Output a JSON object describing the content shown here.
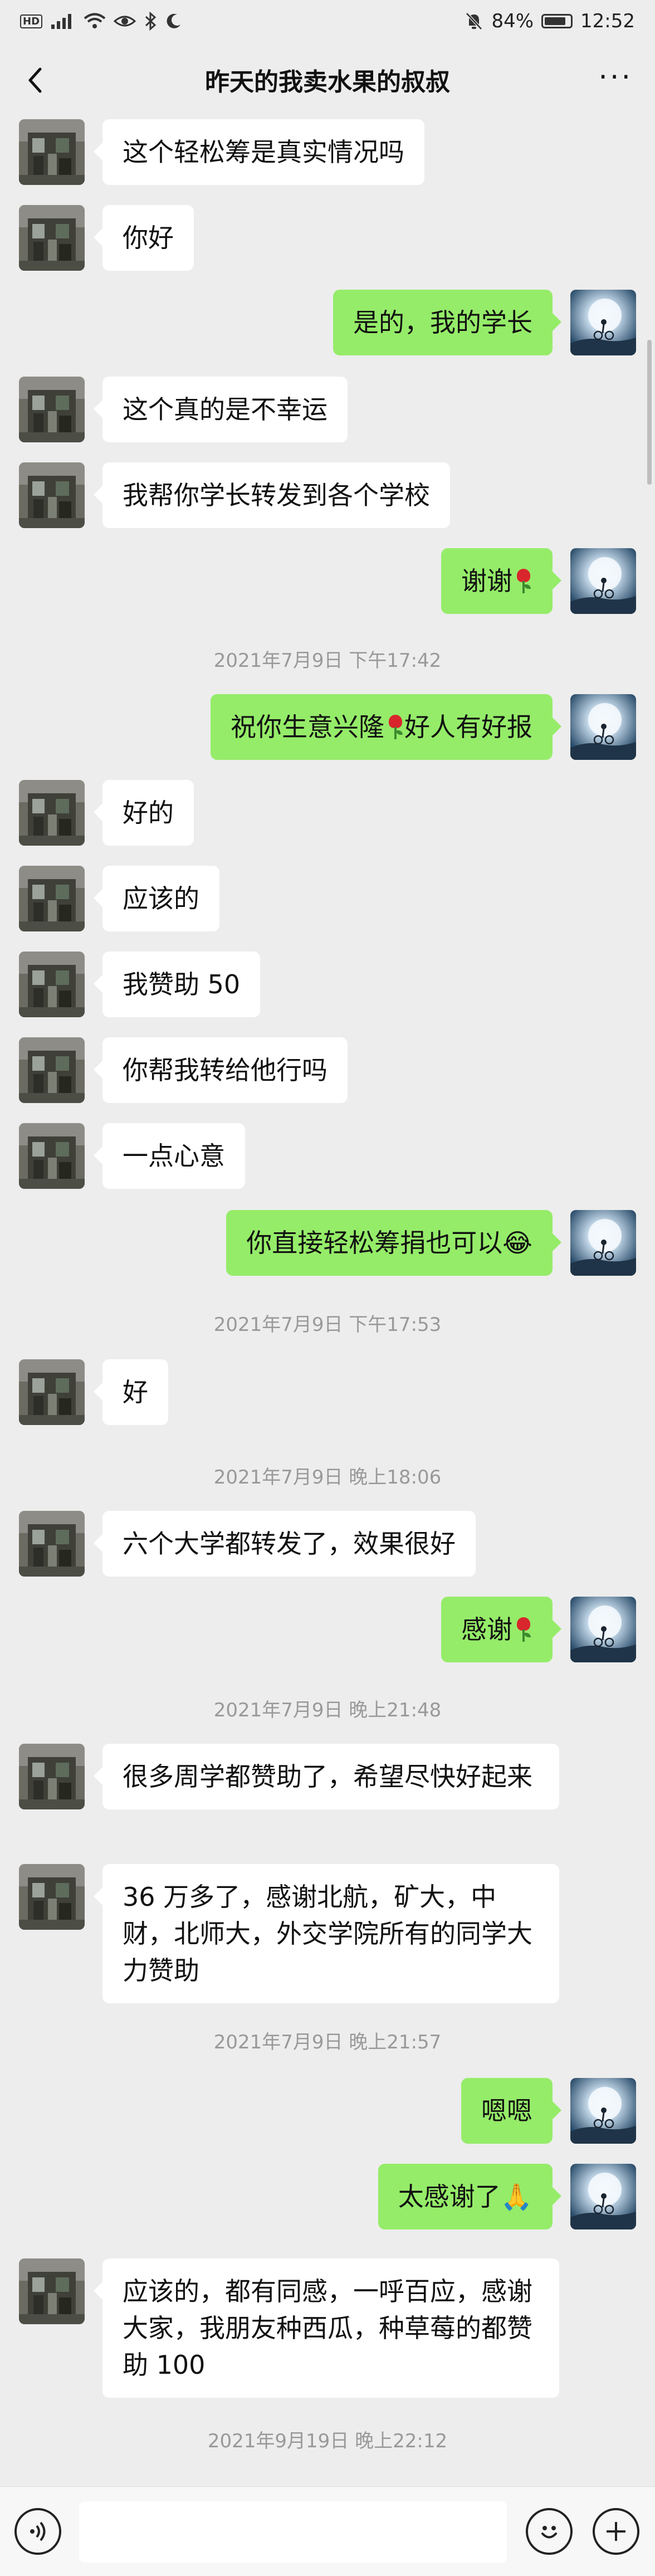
{
  "status": {
    "battery": "84%",
    "battery_level": 0.84,
    "time": "12:52",
    "left_icons": [
      "hd-icon",
      "signal-icon",
      "wifi-icon",
      "eye-icon",
      "bluetooth-icon",
      "moon-icon"
    ]
  },
  "nav": {
    "title": "昨天的我卖水果的叔叔"
  },
  "colors": {
    "background": "#ededed",
    "sent_bubble": "#95ec69",
    "received_bubble": "#ffffff",
    "timestamp_text": "#999999"
  },
  "messages": [
    {
      "side": "left",
      "text": "这个轻松筹是真实情况吗"
    },
    {
      "side": "left",
      "text": "你好"
    },
    {
      "side": "right",
      "text": "是的，我的学长"
    },
    {
      "side": "left",
      "text": "这个真的是不幸运"
    },
    {
      "side": "left",
      "text": "我帮你学长转发到各个学校"
    },
    {
      "side": "right",
      "text": "谢谢",
      "emoji": "rose"
    },
    {
      "type": "time",
      "text": "2021年7月9日 下午17:42"
    },
    {
      "side": "right",
      "text": "祝你生意兴隆",
      "emoji": "rose",
      "text_after": "好人有好报"
    },
    {
      "side": "left",
      "text": "好的"
    },
    {
      "side": "left",
      "text": "应该的"
    },
    {
      "side": "left",
      "text": "我赞助 50"
    },
    {
      "side": "left",
      "text": "你帮我转给他行吗"
    },
    {
      "side": "left",
      "text": "一点心意"
    },
    {
      "side": "right",
      "text": "你直接轻松筹捐也可以😂"
    },
    {
      "type": "time",
      "text": "2021年7月9日 下午17:53"
    },
    {
      "side": "left",
      "text": "好"
    },
    {
      "type": "time",
      "text": "2021年7月9日 晚上18:06"
    },
    {
      "side": "left",
      "text": "六个大学都转发了，效果很好"
    },
    {
      "side": "right",
      "text": "感谢",
      "emoji": "rose"
    },
    {
      "type": "time",
      "text": "2021年7月9日 晚上21:48"
    },
    {
      "side": "left",
      "text": "很多周学都赞助了，希望尽快好起来"
    },
    {
      "side": "left",
      "text": "36 万多了，感谢北航，矿大，中财，北师大，外交学院所有的同学大力赞助"
    },
    {
      "type": "time",
      "text": "2021年7月9日 晚上21:57"
    },
    {
      "side": "right",
      "text": "嗯嗯"
    },
    {
      "side": "right",
      "text": "太感谢了🙏"
    },
    {
      "side": "left",
      "text": "应该的，都有同感，一呼百应，感谢大家，我朋友种西瓜，种草莓的都赞助 100"
    },
    {
      "type": "time",
      "text": "2021年9月19日 晚上22:12"
    }
  ]
}
